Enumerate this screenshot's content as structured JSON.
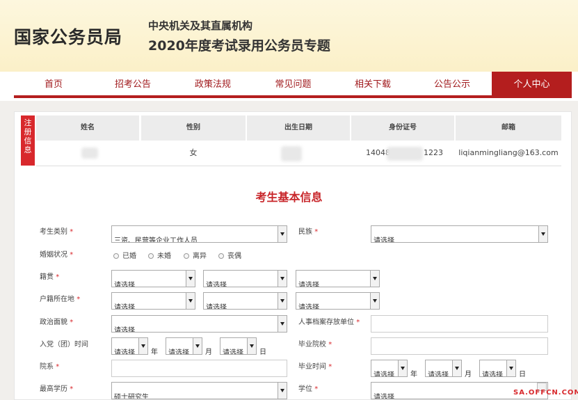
{
  "header": {
    "logo": "国家公务员局",
    "subtitle1": "中央机关及其直属机构",
    "subtitle2": "2020年度考试录用公务员专题"
  },
  "nav": [
    "首页",
    "招考公告",
    "政策法规",
    "常见问题",
    "相关下载",
    "公告公示",
    "个人中心"
  ],
  "nav_active": "个人中心",
  "registration": {
    "tag": "注册信息",
    "headers": [
      "姓名",
      "性别",
      "出生日期",
      "身份证号",
      "邮箱"
    ],
    "row": {
      "gender": "女",
      "id_prefix": "14048",
      "id_suffix": "1223",
      "email": "liqianmingliang@163.com"
    }
  },
  "form_title": "考生基本信息",
  "req_mark": "*",
  "labels": {
    "category": "考生类别",
    "ethnicity": "民族",
    "marital": "婚姻状况",
    "native": "籍贯",
    "household": "户籍所在地",
    "political": "政治面貌",
    "archive_unit": "人事档案存放单位",
    "party_date": "入党（团）时间",
    "graduate_school": "毕业院校",
    "department": "院系",
    "graduate_date": "毕业时间",
    "education": "最高学历",
    "degree": "学位"
  },
  "values": {
    "category": "三资、民营等企业工作人员",
    "select_placeholder": "请选择",
    "education": "硕士研究生"
  },
  "marital_options": [
    "已婚",
    "未婚",
    "离异",
    "丧偶"
  ],
  "date_units": {
    "year": "年",
    "month": "月",
    "day": "日"
  },
  "watermark": "SA.OFFCN.COM"
}
